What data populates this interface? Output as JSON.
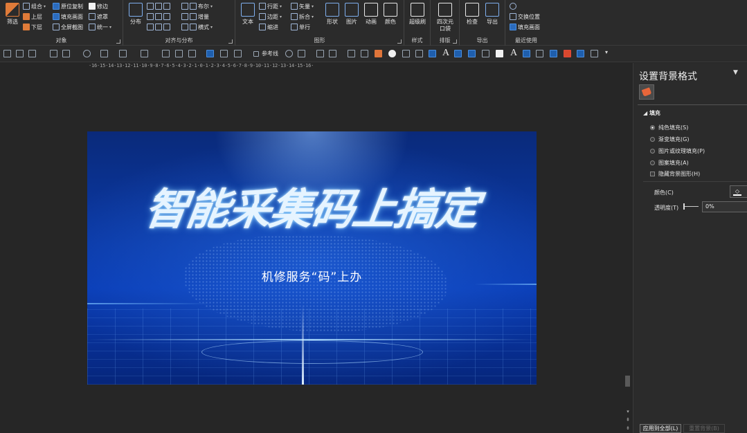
{
  "ribbon": {
    "group_object": {
      "label": "对象",
      "filter": "筛选",
      "combine": "组合",
      "bring_up": "上层",
      "send_down": "下层",
      "copy_in_place": "原位复制",
      "fill_canvas": "填充画面",
      "fullscreen_crop": "全屏截图",
      "modify": "修边",
      "mask": "遮罩",
      "unify": "统一"
    },
    "group_align": {
      "label": "对齐与分布",
      "distribute": "分布",
      "boolean": "布尔",
      "grow": "增量",
      "horizontal": "横式"
    },
    "group_shape": {
      "label": "图形",
      "text": "文本",
      "line_spacing": "行距",
      "margin": "边距",
      "indent": "缩进",
      "vector": "矢量",
      "split": "拆合",
      "single_line": "单行",
      "shape": "形状",
      "picture": "图片",
      "animation": "动画",
      "color": "颜色"
    },
    "group_style": {
      "label": "样式",
      "format_painter": "超级刷"
    },
    "group_layout": {
      "label": "排版",
      "quadrant": "四次元口袋"
    },
    "group_export": {
      "label": "导出",
      "check": "检查",
      "export": "导出"
    },
    "group_recent": {
      "label": "最近使用",
      "swap": "交换位置",
      "fill_canvas": "填充画面"
    }
  },
  "toolbar": {
    "guides": "参考线"
  },
  "ruler": {
    "marks": "·16·15·14·13·12·11·10·9·8·7·6·5·4·3·2·1·0·1·2·3·4·5·6·7·8·9·10·11·12·13·14·15·16·"
  },
  "slide": {
    "title": "智能采集码上搞定",
    "subtitle": "机修服务“码”上办"
  },
  "pane": {
    "title": "设置背景格式",
    "section_fill": "填充",
    "options": [
      {
        "label": "纯色填充(S)",
        "selected": true
      },
      {
        "label": "渐变填充(G)",
        "selected": false
      },
      {
        "label": "图片或纹理填充(P)",
        "selected": false
      },
      {
        "label": "图案填充(A)",
        "selected": false
      }
    ],
    "hide_bg_graphics": "隐藏背景图形(H)",
    "color_label": "颜色(C)",
    "transparency_label": "透明度(T)",
    "transparency_value": "0%",
    "apply_all": "应用到全部(L)",
    "reset_bg": "重置背景(B)"
  },
  "colors": {
    "accent_orange": "#e07b39",
    "panel_bg": "#2b2b2b",
    "canvas_bg": "#262626",
    "slide_blue": "#0b3aa8"
  }
}
